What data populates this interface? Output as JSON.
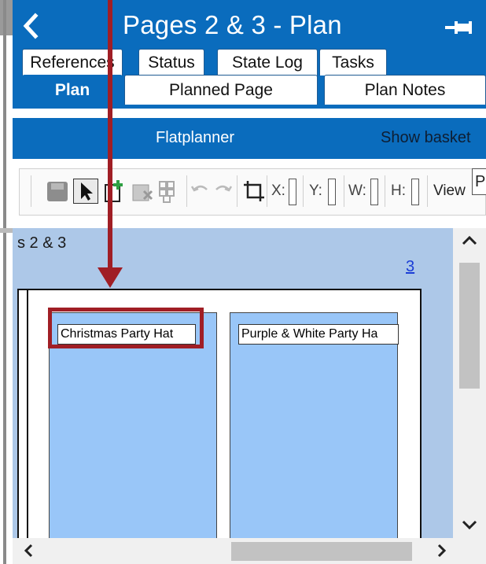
{
  "panel": {
    "title": "Pages 2 & 3 - Plan",
    "back_icon": "chevron-left-icon",
    "pin_icon": "pin-icon"
  },
  "tabs": {
    "row1": [
      "References",
      "Status",
      "State Log",
      "Tasks"
    ],
    "row2": [
      "Plan",
      "Planned Page",
      "Plan Notes"
    ],
    "active": "Plan"
  },
  "flatplanner_bar": {
    "title": "Flatplanner",
    "show_basket": "Show basket"
  },
  "toolbar": {
    "icons": [
      "save-icon",
      "select-pointer-icon",
      "add-page-icon",
      "delete-icon",
      "grid-icon",
      "undo-icon",
      "redo-icon",
      "crop-icon"
    ],
    "x_label": "X:",
    "y_label": "Y:",
    "w_label": "W:",
    "h_label": "H:",
    "view_label": "View",
    "view_value": "P"
  },
  "canvas": {
    "pages_label": "s 2 & 3",
    "page_number_link": "3",
    "slots": [
      {
        "title": "Christmas Party Hat"
      },
      {
        "title": "Purple & White Party Ha"
      }
    ]
  },
  "colors": {
    "accent": "#0a6cbd",
    "callout": "#a01e25",
    "canvas_bg": "#adc8e8",
    "slot_fill": "#99c6f8",
    "link": "#1b3dd6"
  }
}
